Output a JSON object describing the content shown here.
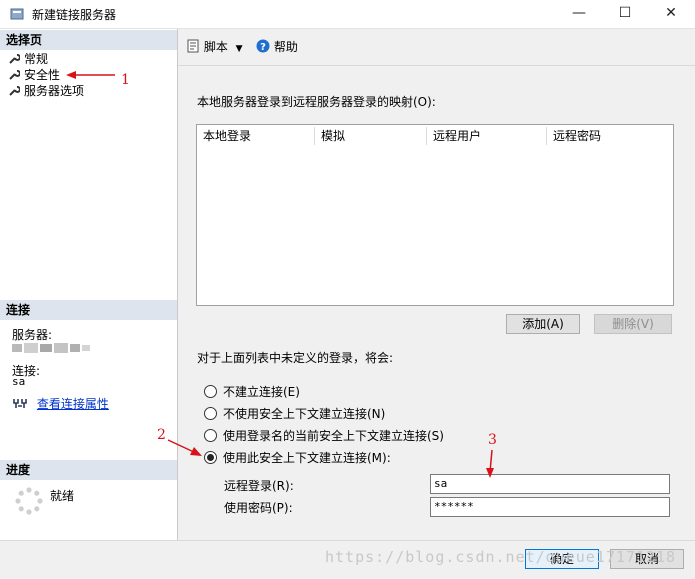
{
  "window": {
    "title": "新建链接服务器",
    "minimize": "—",
    "maximize": "☐",
    "close": "✕"
  },
  "left": {
    "select_page": "选择页",
    "nav": [
      {
        "label": "常规"
      },
      {
        "label": "安全性"
      },
      {
        "label": "服务器选项"
      }
    ],
    "connection_head": "连接",
    "server_label": "服务器:",
    "connection_label": "连接:",
    "connection_value": "sa",
    "view_props": "查看连接属性",
    "progress_head": "进度",
    "progress_status": "就绪"
  },
  "toolbar": {
    "script": "脚本",
    "help": "帮助"
  },
  "mapping": {
    "label": "本地服务器登录到远程服务器登录的映射(O):",
    "columns": [
      "本地登录",
      "模拟",
      "远程用户",
      "远程密码"
    ],
    "add": "添加(A)",
    "remove": "删除(V)"
  },
  "undefined_logins": {
    "label": "对于上面列表中未定义的登录，将会:",
    "options": [
      {
        "label": "不建立连接(E)",
        "selected": false
      },
      {
        "label": "不使用安全上下文建立连接(N)",
        "selected": false
      },
      {
        "label": "使用登录名的当前安全上下文建立连接(S)",
        "selected": false
      },
      {
        "label": "使用此安全上下文建立连接(M):",
        "selected": true
      }
    ],
    "remote_login_label": "远程登录(R):",
    "remote_login_value": "sa",
    "password_label": "使用密码(P):",
    "password_value": "******"
  },
  "footer": {
    "ok": "确定",
    "cancel": "取消"
  },
  "annotations": {
    "a1": "1",
    "a2": "2",
    "a3": "3"
  },
  "watermark": "https://blog.csdn.net/queue17171218",
  "colors": {
    "annotation": "#d8121b",
    "section_header": "#dde4ee"
  }
}
